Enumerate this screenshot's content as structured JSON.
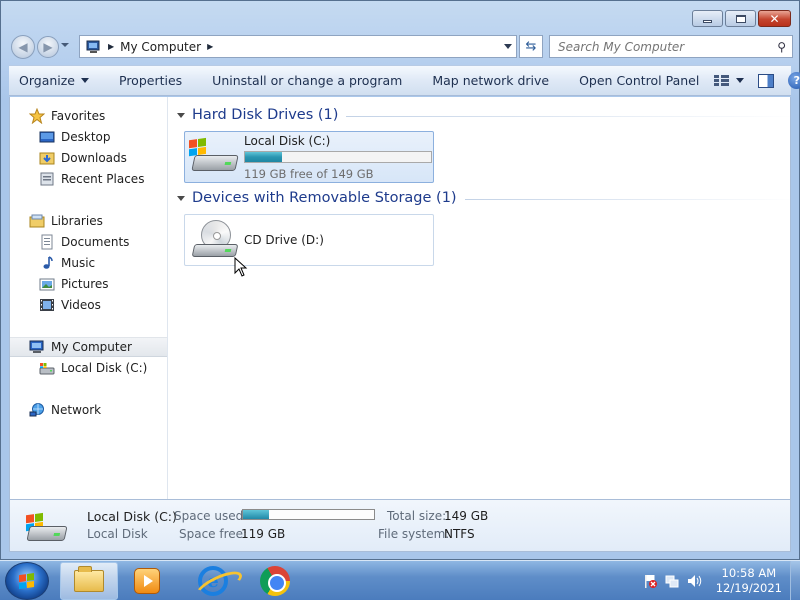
{
  "window": {
    "minimize_glyph": "",
    "maximize_glyph": "",
    "close_glyph": "✕"
  },
  "address": {
    "location": "My Computer",
    "search_placeholder": "Search My Computer"
  },
  "toolbar": {
    "organize": "Organize",
    "properties": "Properties",
    "uninstall": "Uninstall or change a program",
    "map_drive": "Map network drive",
    "control_panel": "Open Control Panel",
    "help": "?"
  },
  "sidebar": {
    "favorites": "Favorites",
    "desktop": "Desktop",
    "downloads": "Downloads",
    "recent": "Recent Places",
    "libraries": "Libraries",
    "documents": "Documents",
    "music": "Music",
    "pictures": "Pictures",
    "videos": "Videos",
    "computer": "My Computer",
    "local_disk": "Local Disk (C:)",
    "network": "Network"
  },
  "groups": {
    "hdd": "Hard Disk Drives (1)",
    "removable": "Devices with Removable Storage (1)"
  },
  "drives": {
    "c": {
      "name": "Local Disk (C:)",
      "free_text": "119 GB free of 149 GB",
      "used_fraction": 0.2
    },
    "d": {
      "name": "CD Drive (D:)"
    }
  },
  "details": {
    "name": "Local Disk (C:)",
    "type": "Local Disk",
    "space_used_label": "Space used:",
    "space_free_label": "Space free:",
    "space_free": "119 GB",
    "total_size_label": "Total size:",
    "total_size": "149 GB",
    "filesystem_label": "File system:",
    "filesystem": "NTFS",
    "used_fraction": 0.2
  },
  "taskbar": {
    "time": "10:58 AM",
    "date": "12/19/2021"
  }
}
